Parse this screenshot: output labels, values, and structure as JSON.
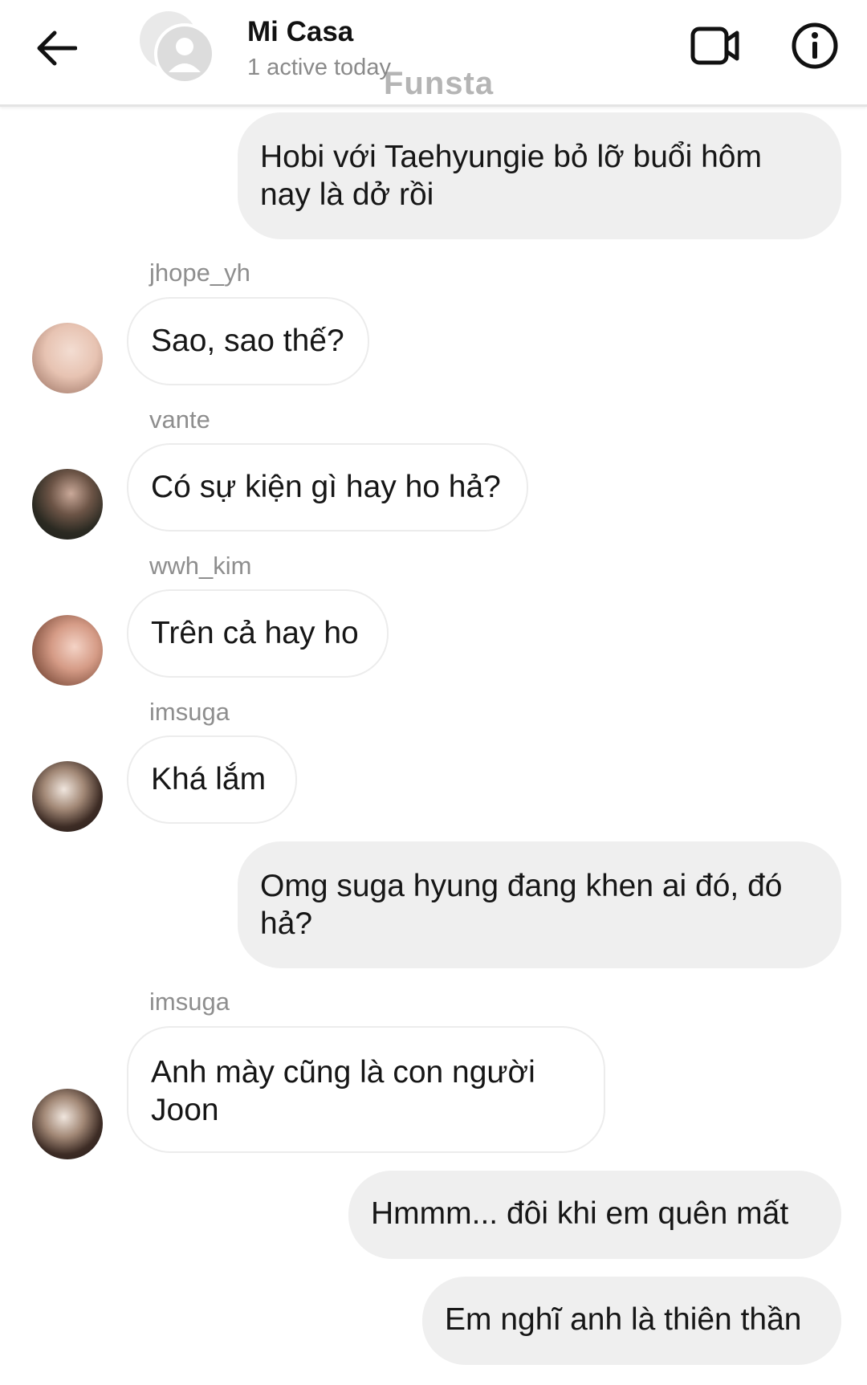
{
  "header": {
    "title": "Mi Casa",
    "status": "1 active today",
    "watermark": "Funsta",
    "icons": {
      "back": "back-arrow-icon",
      "group": "group-avatar-icon",
      "video": "video-call-icon",
      "info": "info-icon"
    }
  },
  "messages": [
    {
      "direction": "out",
      "text": "Hobi với Taehyungie bỏ lỡ buổi hôm nay là dở rồi"
    },
    {
      "direction": "in",
      "sender": "jhope_yh",
      "text": "Sao, sao thế?"
    },
    {
      "direction": "in",
      "sender": "vante",
      "text": "Có sự kiện gì hay ho hả?"
    },
    {
      "direction": "in",
      "sender": "wwh_kim",
      "text": "Trên cả hay ho"
    },
    {
      "direction": "in",
      "sender": "imsuga",
      "text": "Khá lắm"
    },
    {
      "direction": "out",
      "text": "Omg suga hyung đang khen ai đó, đó hả?"
    },
    {
      "direction": "in",
      "sender": "imsuga",
      "text": "Anh mày cũng là con người Joon"
    },
    {
      "direction": "out",
      "text": "Hmmm... đôi khi em quên mất"
    },
    {
      "direction": "out",
      "text": "Em nghĩ anh là thiên thần"
    }
  ]
}
